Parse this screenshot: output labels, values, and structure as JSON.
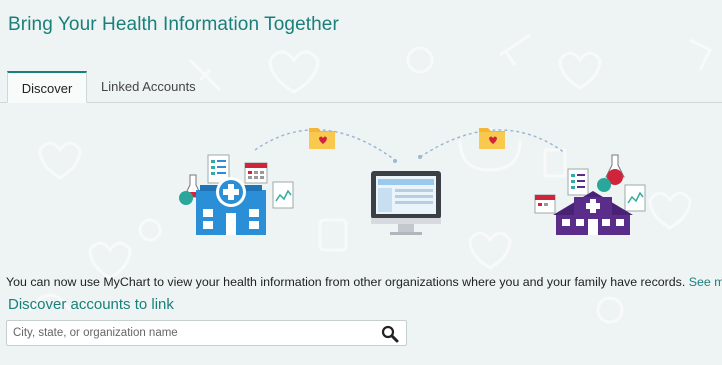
{
  "header": {
    "title": "Bring Your Health Information Together"
  },
  "tabs": [
    {
      "label": "Discover",
      "active": true
    },
    {
      "label": "Linked Accounts",
      "active": false
    }
  ],
  "main": {
    "description": "You can now use MyChart to view your health information from other organizations where you and your family have records.",
    "see_more_label": "See more",
    "section_heading": "Discover accounts to link"
  },
  "search": {
    "placeholder": "City, state, or organization name",
    "value": "",
    "icon": "search-icon"
  },
  "colors": {
    "accent": "#1a7f7b",
    "hospital_blue": "#2b8fd8",
    "hospital_purple": "#5a2d8a",
    "folder": "#f5b731",
    "heart": "#d0243c"
  }
}
